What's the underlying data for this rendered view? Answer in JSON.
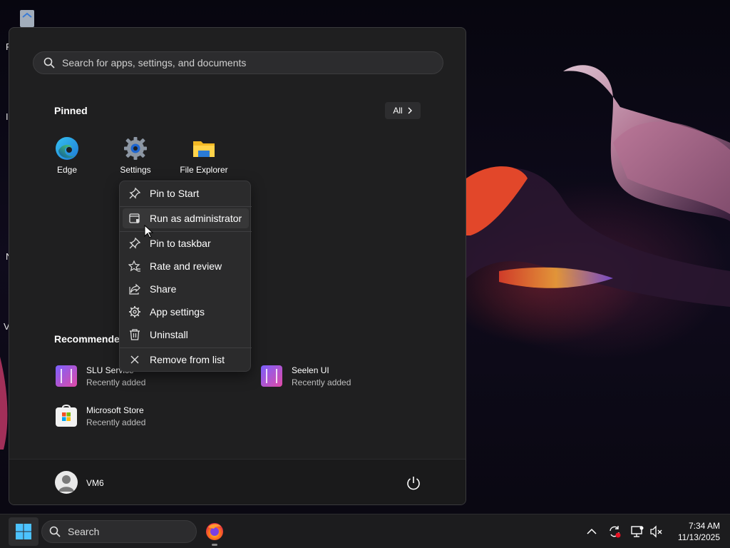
{
  "desktop": {
    "edge_letters": [
      "R",
      "I",
      "N",
      "V"
    ]
  },
  "start_menu": {
    "search": {
      "placeholder": "Search for apps, settings, and documents"
    },
    "pinned": {
      "title": "Pinned",
      "all_label": "All",
      "apps": [
        {
          "label": "Edge",
          "icon": "edge-icon"
        },
        {
          "label": "Settings",
          "icon": "gear-icon"
        },
        {
          "label": "File Explorer",
          "icon": "folder-icon"
        }
      ]
    },
    "recommended": {
      "title": "Recommended",
      "items": [
        {
          "name": "SLU Service",
          "sub": "Recently added",
          "icon": "app-tile-icon"
        },
        {
          "name": "Seelen UI",
          "sub": "Recently added",
          "icon": "app-tile-icon"
        },
        {
          "name": "Microsoft Store",
          "sub": "Recently added",
          "icon": "store-icon"
        }
      ]
    },
    "user": {
      "name": "VM6"
    }
  },
  "context_menu": {
    "items": [
      {
        "label": "Pin to Start",
        "icon": "pin-icon"
      },
      {
        "label": "Run as administrator",
        "icon": "shield-window-icon"
      },
      {
        "label": "Pin to taskbar",
        "icon": "pin-icon"
      },
      {
        "label": "Rate and review",
        "icon": "star-icon"
      },
      {
        "label": "Share",
        "icon": "share-icon"
      },
      {
        "label": "App settings",
        "icon": "gear-icon"
      },
      {
        "label": "Uninstall",
        "icon": "trash-icon"
      },
      {
        "label": "Remove from list",
        "icon": "close-icon"
      }
    ]
  },
  "taskbar": {
    "search_label": "Search",
    "clock": {
      "time": "7:34 AM",
      "date": "11/13/2025"
    }
  },
  "colors": {
    "accent": "#0078d4",
    "menu_bg": "#1f1f20",
    "context_bg": "#2b2b2c",
    "taskbar_bg": "#1c1c1e"
  }
}
